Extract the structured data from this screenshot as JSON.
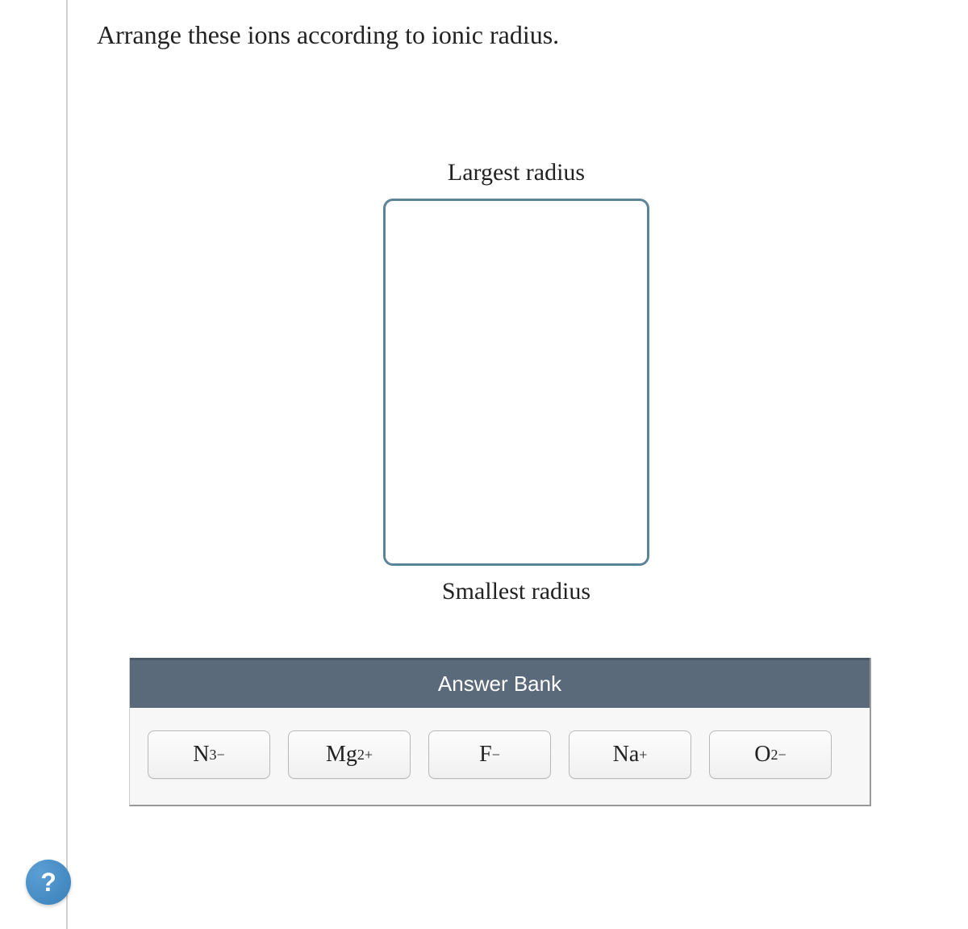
{
  "question": "Arrange these ions according to ionic radius.",
  "labels": {
    "top": "Largest radius",
    "bottom": "Smallest radius"
  },
  "answerBank": {
    "title": "Answer Bank",
    "ions": [
      {
        "base": "N",
        "charge": "3−"
      },
      {
        "base": "Mg",
        "charge": "2+"
      },
      {
        "base": "F",
        "charge": "−"
      },
      {
        "base": "Na",
        "charge": "+"
      },
      {
        "base": "O",
        "charge": "2−"
      }
    ]
  },
  "help": {
    "label": "?"
  }
}
